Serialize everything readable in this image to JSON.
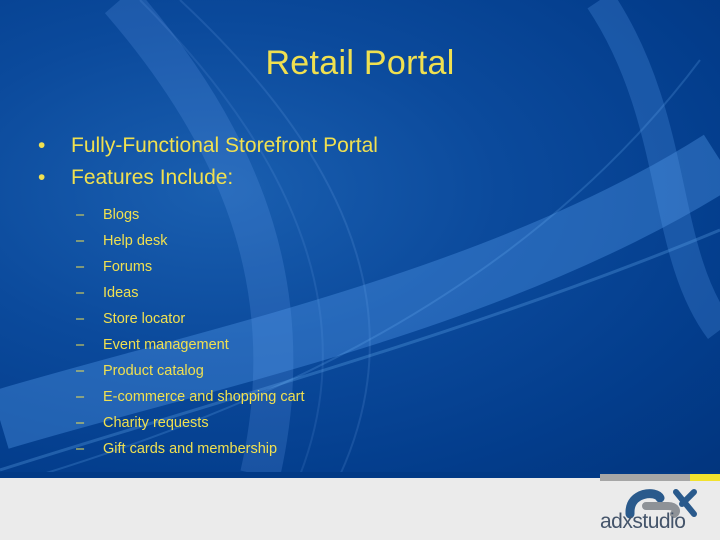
{
  "slide": {
    "title": "Retail Portal",
    "bullets": [
      {
        "marker": "•",
        "text": "Fully-Functional Storefront Portal"
      },
      {
        "marker": "•",
        "text": "Features Include:"
      }
    ],
    "features": [
      {
        "marker": "–",
        "text": "Blogs"
      },
      {
        "marker": "–",
        "text": "Help desk"
      },
      {
        "marker": "–",
        "text": "Forums"
      },
      {
        "marker": "–",
        "text": "Ideas"
      },
      {
        "marker": "–",
        "text": "Store locator"
      },
      {
        "marker": "–",
        "text": "Event management"
      },
      {
        "marker": "–",
        "text": "Product catalog"
      },
      {
        "marker": "–",
        "text": "E-commerce and shopping cart"
      },
      {
        "marker": "–",
        "text": "Charity requests"
      },
      {
        "marker": "–",
        "text": "Gift cards and membership"
      }
    ]
  },
  "footer": {
    "logo_icon": "adx-logo-icon",
    "logo_text": "adxstudio"
  },
  "colors": {
    "background": "#0b4a9c",
    "text_accent": "#f0e050",
    "footer": "#ebebeb",
    "stripe_grey": "#a6a6a6",
    "stripe_yellow": "#f2e22e",
    "logo_blue": "#2a5a8c",
    "logo_grey": "#8e9297"
  }
}
